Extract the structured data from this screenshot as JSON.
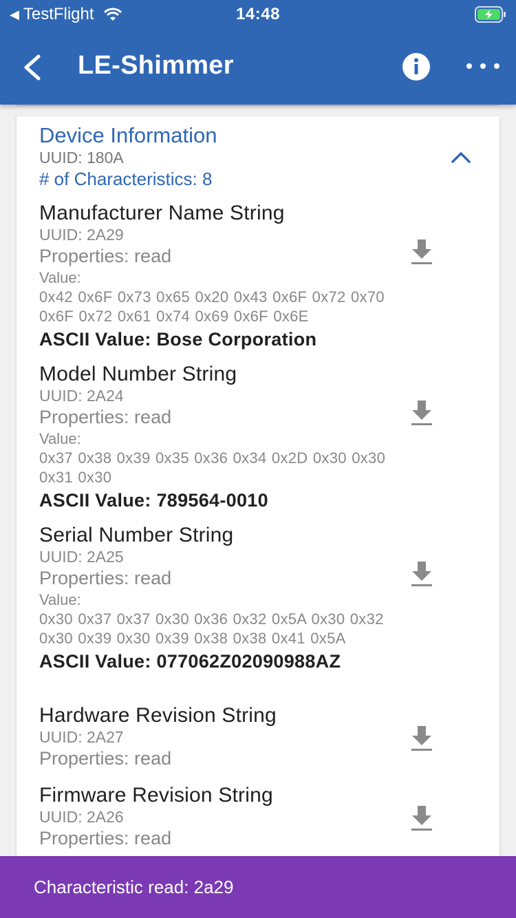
{
  "status_bar": {
    "back_app": "TestFlight",
    "time": "14:48"
  },
  "app_bar": {
    "title": "LE-Shimmer"
  },
  "service": {
    "name": "Device Information",
    "uuid": "UUID: 180A",
    "count": "# of Characteristics: 8"
  },
  "characteristics": [
    {
      "name": "Manufacturer Name String",
      "uuid": "UUID: 2A29",
      "properties": "Properties: read",
      "value_label": "Value:",
      "value": "0x42 0x6F 0x73 0x65 0x20 0x43 0x6F 0x72 0x70 0x6F 0x72 0x61 0x74 0x69 0x6F 0x6E",
      "ascii": "ASCII Value: Bose Corporation"
    },
    {
      "name": "Model Number String",
      "uuid": "UUID: 2A24",
      "properties": "Properties: read",
      "value_label": "Value:",
      "value": "0x37 0x38 0x39 0x35 0x36 0x34 0x2D 0x30 0x30 0x31 0x30",
      "ascii": "ASCII Value: 789564-0010"
    },
    {
      "name": "Serial Number String",
      "uuid": "UUID: 2A25",
      "properties": "Properties: read",
      "value_label": "Value:",
      "value": "0x30 0x37 0x37 0x30 0x36 0x32 0x5A 0x30 0x32 0x30 0x39 0x30 0x39 0x38 0x38 0x41 0x5A",
      "ascii": "ASCII Value: 077062Z02090988AZ"
    },
    {
      "name": "Hardware Revision String",
      "uuid": "UUID: 2A27",
      "properties": "Properties: read"
    },
    {
      "name": "Firmware Revision String",
      "uuid": "UUID: 2A26",
      "properties": "Properties: read"
    }
  ],
  "snackbar": {
    "message": "Characteristic read: 2a29"
  },
  "colors": {
    "app_bar": "#2f67b4",
    "snackbar": "#7b3ab3",
    "battery": "#4cd964"
  },
  "icons": [
    "back-arrow-icon",
    "info-icon",
    "more-icon",
    "chevron-up-icon",
    "download-icon",
    "wifi-icon",
    "battery-charging-icon"
  ]
}
